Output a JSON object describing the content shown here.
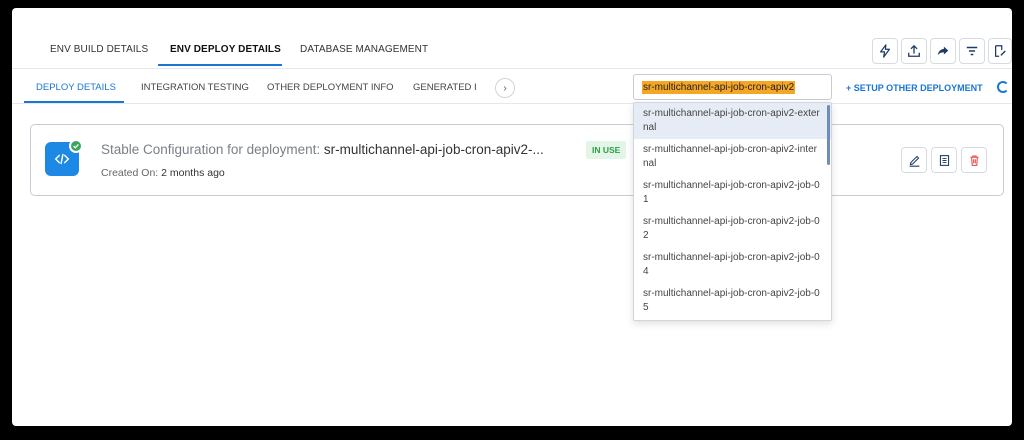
{
  "top_tabs": [
    {
      "label": "ENV BUILD DETAILS"
    },
    {
      "label": "ENV DEPLOY DETAILS"
    },
    {
      "label": "DATABASE MANAGEMENT"
    }
  ],
  "toolbar_icons": [
    "bolt-icon",
    "upload-icon",
    "share-icon",
    "filter-icon",
    "edit-doc-icon"
  ],
  "sub_tabs": [
    {
      "label": "DEPLOY DETAILS"
    },
    {
      "label": "INTEGRATION TESTING"
    },
    {
      "label": "OTHER DEPLOYMENT INFO"
    },
    {
      "label": "GENERATED I"
    }
  ],
  "deployment_select": {
    "value": "sr-multichannel-api-job-cron-apiv2"
  },
  "setup_link": "+ SETUP OTHER DEPLOYMENT",
  "card": {
    "title_prefix": "Stable Configuration for deployment: ",
    "title_name": "sr-multichannel-api-job-cron-apiv2-...",
    "status": "IN USE",
    "created_prefix": "Created On: ",
    "created_value": "2 months ago"
  },
  "dropdown": {
    "options": [
      "sr-multichannel-api-job-cron-apiv2-external",
      "sr-multichannel-api-job-cron-apiv2-internal",
      "sr-multichannel-api-job-cron-apiv2-job-01",
      "sr-multichannel-api-job-cron-apiv2-job-02",
      "sr-multichannel-api-job-cron-apiv2-job-04",
      "sr-multichannel-api-job-cron-apiv2-job-05"
    ]
  },
  "colors": {
    "accent": "#1976d2",
    "highlight": "#f5a623",
    "success": "#3ba55c",
    "danger": "#e04848"
  }
}
